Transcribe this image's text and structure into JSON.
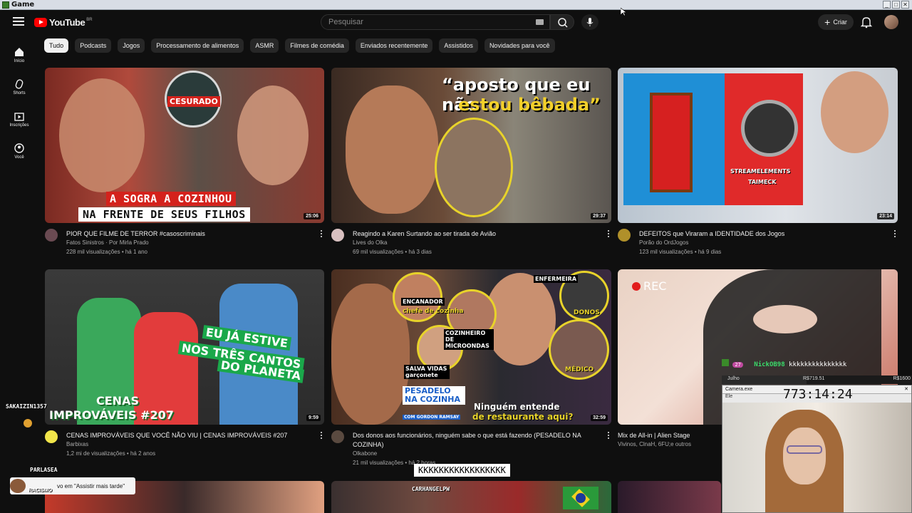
{
  "window": {
    "title": "Game"
  },
  "masthead": {
    "logo_text": "YouTube",
    "logo_country": "BR",
    "search_placeholder": "Pesquisar",
    "create_label": "Criar"
  },
  "sidebar": {
    "items": [
      {
        "label": "Início",
        "icon": "home-icon"
      },
      {
        "label": "Shorts",
        "icon": "shorts-icon"
      },
      {
        "label": "Inscrições",
        "icon": "subscriptions-icon"
      },
      {
        "label": "Você",
        "icon": "you-icon"
      }
    ]
  },
  "chips": [
    "Tudo",
    "Podcasts",
    "Jogos",
    "Processamento de alimentos",
    "ASMR",
    "Filmes de comédia",
    "Enviados recentemente",
    "Assistidos",
    "Novidades para você"
  ],
  "videos": [
    {
      "title": "PIOR QUE FILME DE TERROR #casoscriminais",
      "channel": "Fatos Sinistros · Por Mirla Prado",
      "stats": "228 mil visualizações • há 1 ano",
      "duration": "25:06",
      "overlay_top": "CESURADO",
      "overlay_1": "A SOGRA A COZINHOU",
      "overlay_2": "NA FRENTE DE SEUS FILHOS"
    },
    {
      "title": "Reagindo a Karen Surtando ao ser tirada de Avião",
      "channel": "Lives do Olka",
      "stats": "69 mil visualizações • há 3 dias",
      "duration": "29:37",
      "overlay_1": "“aposto que eu não",
      "overlay_2": "estou bêbada”"
    },
    {
      "title": "DEFEITOS que Viraram a IDENTIDADE dos Jogos",
      "channel": "Porão do OrdJogos",
      "stats": "123 mil visualizações • há 9 dias",
      "duration": "23:14",
      "overlay_1": "STREAMELEMENTS",
      "overlay_2": "TAIMECK"
    },
    {
      "title": "CENAS IMPROVÁVEIS QUE VOCÊ NÃO VIU | CENAS IMPROVÁVEIS #207",
      "channel": "Barbixas",
      "stats": "1,2 mi de visualizações • há 2 anos",
      "duration": "9:59",
      "overlay_1": "EU JÁ ESTIVE",
      "overlay_2": "NOS TRÊS CANTOS",
      "overlay_3": "DO PLANETA",
      "overlay_4": "CENAS",
      "overlay_5": "IMPROVÁVEIS #207"
    },
    {
      "title": "Dos donos aos funcionários, ninguém sabe o que está fazendo (PESADELO NA COZINHA)",
      "channel": "Olkabone",
      "stats": "21 mil visualizações • há 2 horas",
      "duration": "32:59",
      "overlay_1": "ENCANADOR",
      "overlay_2": "chefe de cozinha",
      "overlay_3": "COZINHEIRO DE MICROONDAS",
      "overlay_4": "SALVA VIDAS garçonete",
      "overlay_5": "ENFERMEIRA",
      "overlay_6": "DONOS",
      "overlay_7": "MÉDICO",
      "overlay_8": "PESADELO NA COZINHA",
      "overlay_9": "COM GORDON RAMSAY",
      "overlay_10": "Ninguém entende",
      "overlay_11": "de restaurante aqui?"
    },
    {
      "title": "Mix de All-in  |  Alien Stage",
      "channel": "Vivinos, ClnaH, 6FU;e outros",
      "stats": "",
      "duration": "",
      "overlay_1": "REC"
    }
  ],
  "stream_overlay": {
    "viewer_name": "SAKAIZIN1357",
    "chat_user": "NickOB98",
    "chat_msg": "kkkkkkkkkkkkkkk",
    "chat_badge": "27",
    "split_label": "Julho",
    "split_val1": "R$719.51",
    "split_val2": "R$1600",
    "cam_title": "Camera.exe",
    "cam_sub": "Ele",
    "timer": "773:14:24",
    "big_chat": "KKKKKKKKKKKKKKKKK",
    "bottom_user": "CARHANGELPW",
    "bottom_user2": "PARLASEA",
    "tooltip": "vo em \"Assistir mais tarde\"",
    "tooltip_user": "RACISMO"
  },
  "colors": {
    "bg": "#0f0f0f",
    "accent": "#ff0000",
    "chip": "#272727"
  }
}
